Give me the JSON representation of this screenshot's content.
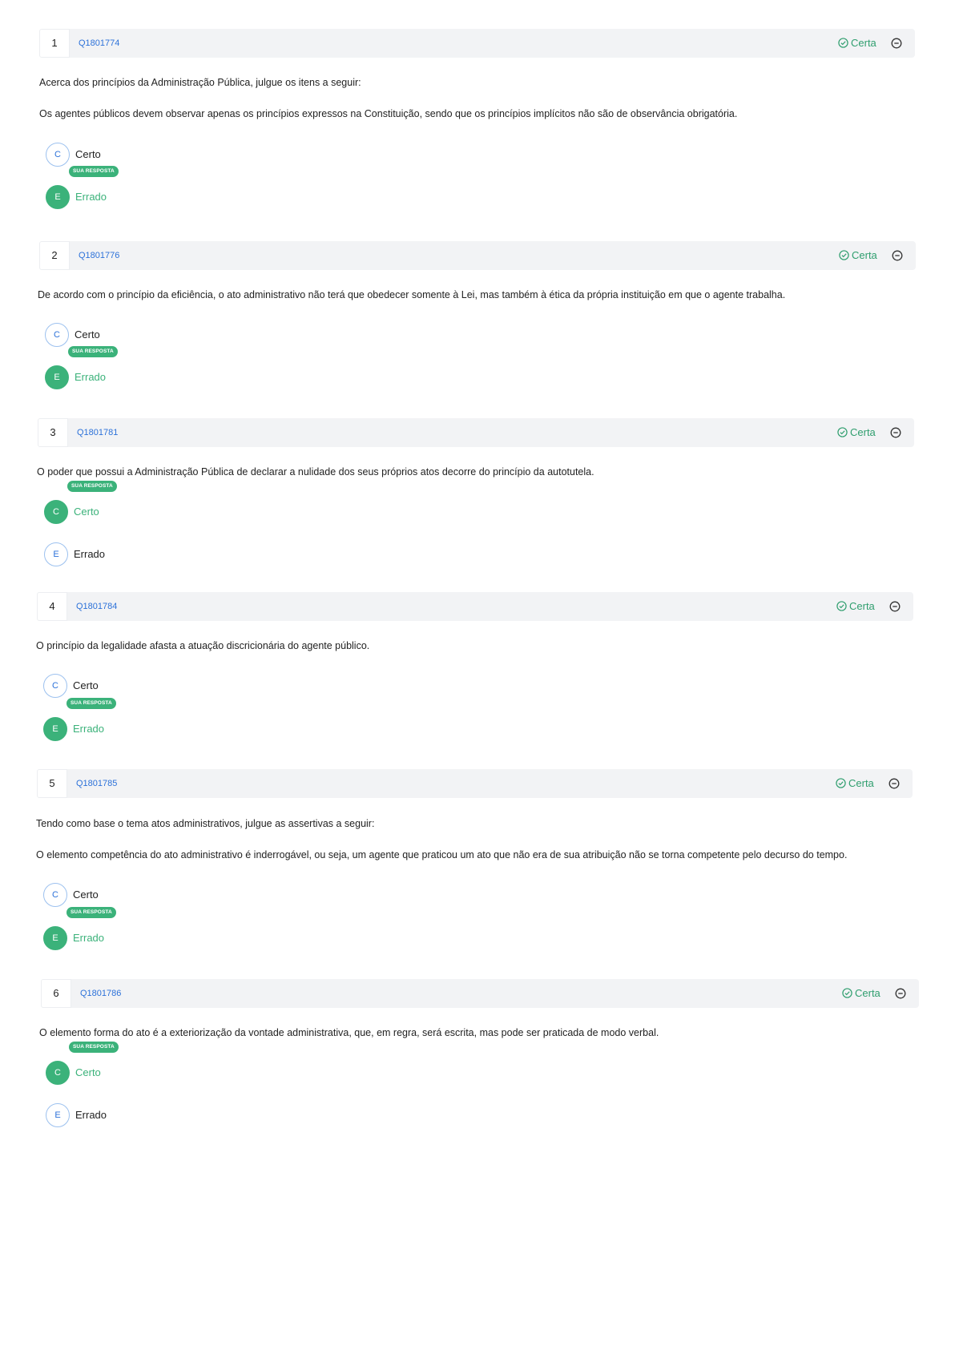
{
  "labels": {
    "badge": "SUA RESPOSTA"
  },
  "colors": {
    "accent": "#3bb27a",
    "link": "#2d72d9",
    "header_bg": "#f2f3f5"
  },
  "questions": [
    {
      "num": "1",
      "id": "Q1801774",
      "status": "Certa",
      "intro": "Acerca dos princípios da Administração Pública, julgue os itens a seguir:",
      "statement": "Os agentes públicos devem observar apenas os princípios expressos na Constituição, sendo que os princípios implícitos não são de observância obrigatória.",
      "options": [
        {
          "letter": "C",
          "label": "Certo",
          "selected": false
        },
        {
          "letter": "E",
          "label": "Errado",
          "selected": true
        }
      ]
    },
    {
      "num": "2",
      "id": "Q1801776",
      "status": "Certa",
      "statement": "De acordo com o princípio da eficiência, o ato administrativo não terá que obedecer somente à Lei, mas também à ética da própria instituição em que o agente trabalha.",
      "options": [
        {
          "letter": "C",
          "label": "Certo",
          "selected": false
        },
        {
          "letter": "E",
          "label": "Errado",
          "selected": true
        }
      ]
    },
    {
      "num": "3",
      "id": "Q1801781",
      "status": "Certa",
      "statement": "O poder que possui a Administração Pública de declarar a nulidade dos seus próprios atos decorre do princípio da autotutela.",
      "options": [
        {
          "letter": "C",
          "label": "Certo",
          "selected": true
        },
        {
          "letter": "E",
          "label": "Errado",
          "selected": false
        }
      ]
    },
    {
      "num": "4",
      "id": "Q1801784",
      "status": "Certa",
      "statement": "O princípio da legalidade afasta a atuação discricionária do agente público.",
      "options": [
        {
          "letter": "C",
          "label": "Certo",
          "selected": false
        },
        {
          "letter": "E",
          "label": "Errado",
          "selected": true
        }
      ]
    },
    {
      "num": "5",
      "id": "Q1801785",
      "status": "Certa",
      "intro": "Tendo como base o tema atos administrativos, julgue as assertivas a seguir:",
      "statement": "O elemento competência do ato administrativo é inderrogável, ou seja, um agente que praticou um ato que não era de sua atribuição não se torna competente pelo decurso do tempo.",
      "options": [
        {
          "letter": "C",
          "label": "Certo",
          "selected": false
        },
        {
          "letter": "E",
          "label": "Errado",
          "selected": true
        }
      ]
    },
    {
      "num": "6",
      "id": "Q1801786",
      "status": "Certa",
      "statement": "O elemento forma do ato é a exteriorização da vontade administrativa, que, em regra, será escrita, mas pode ser praticada de modo verbal.",
      "options": [
        {
          "letter": "C",
          "label": "Certo",
          "selected": true
        },
        {
          "letter": "E",
          "label": "Errado",
          "selected": false
        }
      ]
    }
  ]
}
